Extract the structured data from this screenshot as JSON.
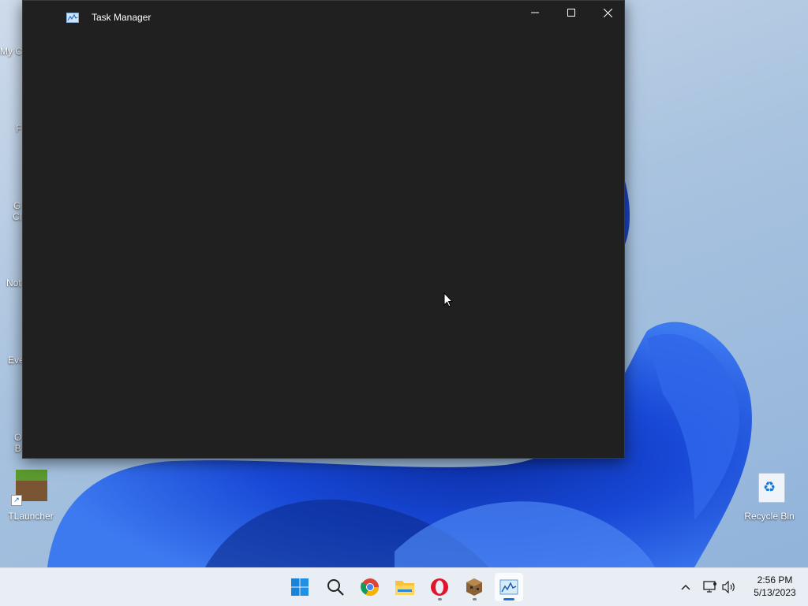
{
  "desktop": {
    "icons": [
      {
        "label": "My C",
        "icon": "this-pc-icon"
      },
      {
        "label": "F",
        "icon": "firefox-icon"
      },
      {
        "label": "G\nCl",
        "icon": "chrome-icon"
      },
      {
        "label": "Not",
        "icon": "notepad-icon"
      },
      {
        "label": "Eve",
        "icon": "everything-icon"
      },
      {
        "label": "O\nB",
        "icon": "opera-icon"
      },
      {
        "label": "TLauncher",
        "icon": "tlauncher-icon"
      },
      {
        "label": "Recycle Bin",
        "icon": "recycle-bin-icon"
      }
    ]
  },
  "window": {
    "title": "Task Manager",
    "buttons": {
      "minimize": "minimize-icon",
      "maximize": "maximize-icon",
      "close": "close-icon"
    }
  },
  "taskbar": {
    "apps": [
      "start-icon",
      "search-icon",
      "chrome-icon",
      "file-explorer-icon",
      "opera-icon",
      "minecraft-icon",
      "task-manager-icon"
    ]
  },
  "tray": {
    "time": "2:56 PM",
    "date": "5/13/2023"
  },
  "colors": {
    "window_bg": "#202020",
    "taskbar_bg": "#e9eef5",
    "accent": "#1a73e8"
  }
}
